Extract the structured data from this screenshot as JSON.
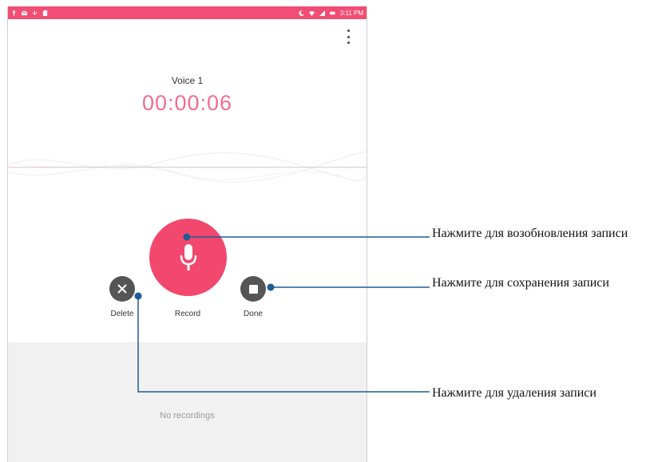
{
  "statusbar": {
    "time": "3:11 PM"
  },
  "recording": {
    "name": "Voice 1",
    "elapsed": "00:00:06"
  },
  "controls": {
    "delete_label": "Delete",
    "record_label": "Record",
    "done_label": "Done"
  },
  "list": {
    "empty_text": "No recordings"
  },
  "callouts": {
    "resume": "Нажмите для возобновления записи",
    "save": "Нажмите для сохранения записи",
    "delete": "Нажмите для удаления записи"
  },
  "colors": {
    "statusbar": "#f24d74",
    "accent": "#f2486d",
    "timer": "#f36d8e",
    "callout_line": "#1f5b95"
  },
  "icons": [
    "microphone-icon",
    "close-icon",
    "stop-icon",
    "overflow-menu-icon"
  ]
}
